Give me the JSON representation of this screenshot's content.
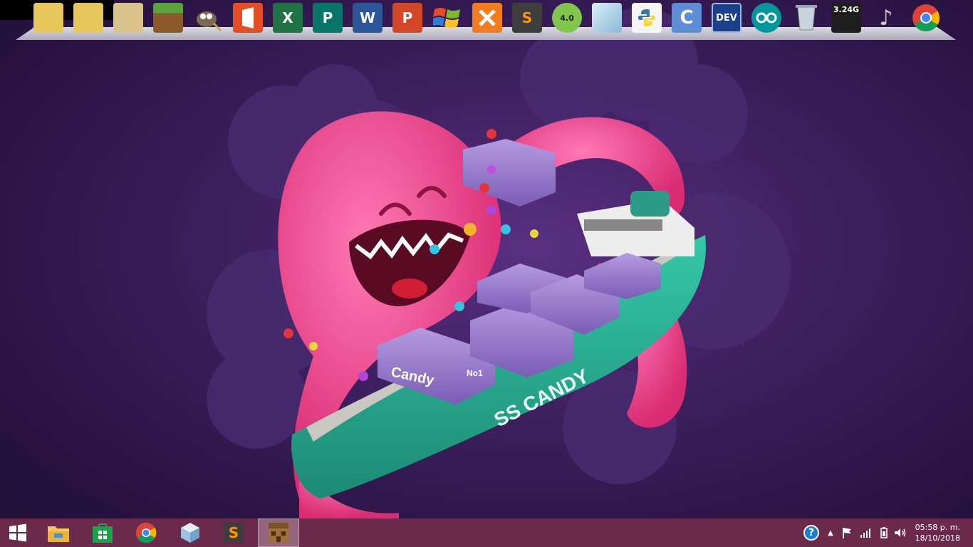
{
  "dock": {
    "items": [
      {
        "name": "folder-1",
        "icon": "folder-icon",
        "label": ""
      },
      {
        "name": "folder-2",
        "icon": "folder-icon",
        "label": ""
      },
      {
        "name": "folder-3",
        "icon": "folder-icon",
        "label": ""
      },
      {
        "name": "minecraft",
        "icon": "grass-block-icon",
        "label": ""
      },
      {
        "name": "gimp",
        "icon": "gimp-icon",
        "label": ""
      },
      {
        "name": "office",
        "icon": "office-icon",
        "label": ""
      },
      {
        "name": "excel",
        "icon": "excel-icon",
        "label": "X"
      },
      {
        "name": "publisher",
        "icon": "publisher-icon",
        "label": "P"
      },
      {
        "name": "word",
        "icon": "word-icon",
        "label": "W"
      },
      {
        "name": "powerpoint",
        "icon": "powerpoint-icon",
        "label": "P"
      },
      {
        "name": "windows-xp",
        "icon": "windows-flag-icon",
        "label": ""
      },
      {
        "name": "xampp",
        "icon": "xampp-icon",
        "label": ""
      },
      {
        "name": "sublime",
        "icon": "sublime-icon",
        "label": "S"
      },
      {
        "name": "robot",
        "icon": "robot-icon",
        "label": "4.0"
      },
      {
        "name": "cube",
        "icon": "cube-icon",
        "label": ""
      },
      {
        "name": "python",
        "icon": "python-icon",
        "label": ""
      },
      {
        "name": "c-lang",
        "icon": "c-icon",
        "label": "C"
      },
      {
        "name": "devcpp",
        "icon": "devcpp-icon",
        "label": "DEV"
      },
      {
        "name": "arduino",
        "icon": "arduino-icon",
        "label": ""
      },
      {
        "name": "recycle-bin",
        "icon": "recycle-bin-icon",
        "label": ""
      },
      {
        "name": "memory-meter",
        "icon": "memory-meter-icon",
        "label": "3.24G"
      },
      {
        "name": "music",
        "icon": "music-note-icon",
        "label": ""
      },
      {
        "name": "chrome",
        "icon": "chrome-icon",
        "label": ""
      }
    ]
  },
  "wallpaper": {
    "ship_name": "SS CANDY",
    "crate_text": "Candy",
    "crate_badge": "No1"
  },
  "taskbar": {
    "start_icon": "windows-logo-icon",
    "pinned": [
      {
        "name": "file-explorer",
        "icon": "folder-icon",
        "active": false
      },
      {
        "name": "store",
        "icon": "store-bag-icon",
        "active": false
      },
      {
        "name": "chrome",
        "icon": "chrome-icon",
        "active": false
      },
      {
        "name": "cube",
        "icon": "cube-icon",
        "active": false
      },
      {
        "name": "sublime",
        "icon": "sublime-icon",
        "active": false
      },
      {
        "name": "minecraft-chest",
        "icon": "crafting-table-icon",
        "active": true
      }
    ],
    "tray": {
      "help_icon": "question-icon",
      "chevron_icon": "chevron-up-icon",
      "flag_icon": "flag-icon",
      "signal_icon": "signal-icon",
      "battery_icon": "battery-icon",
      "volume_icon": "volume-icon",
      "time": "05:58 p. m.",
      "date": "18/10/2018"
    }
  },
  "colors": {
    "taskbar": "#6b2a4c",
    "octopus": "#f0468f",
    "ship_hull": "#2bb59a"
  }
}
